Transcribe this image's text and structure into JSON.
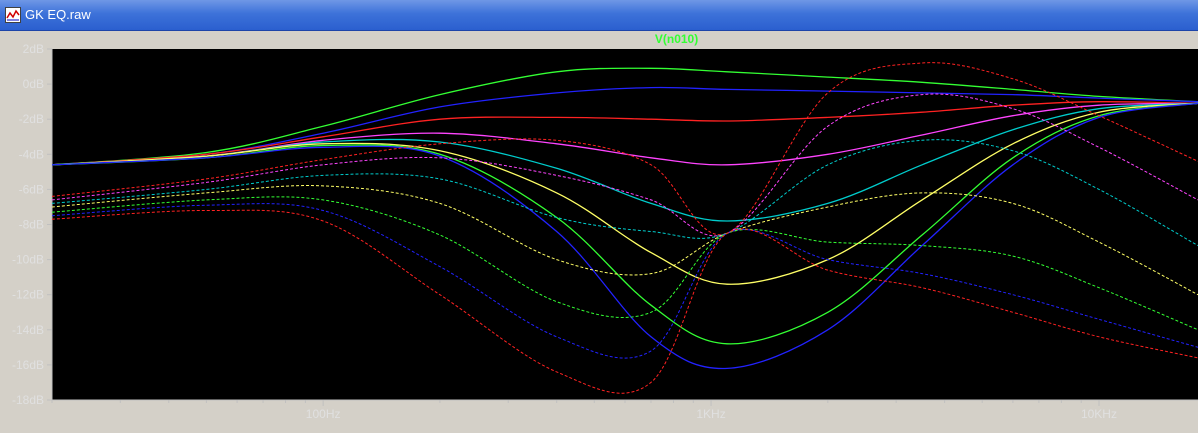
{
  "window": {
    "title": "GK EQ.raw",
    "icon": "waveform-icon"
  },
  "colors": {
    "background": "#000000",
    "axis": "#c0c0c0",
    "trace_title": "#33ff33",
    "palette": [
      "#33ff33",
      "#2222ff",
      "#ff2222",
      "#ff44ff",
      "#00cccc",
      "#ffff66"
    ]
  },
  "chart_data": {
    "type": "line",
    "title": "V(n010)",
    "xlabel": "",
    "ylabel": "",
    "x_scale": "log",
    "xlim": [
      20,
      18000
    ],
    "ylim": [
      -18,
      2
    ],
    "x_ticks": [
      {
        "value": 100,
        "label": "100Hz"
      },
      {
        "value": 1000,
        "label": "1KHz"
      },
      {
        "value": 10000,
        "label": "10KHz"
      }
    ],
    "y_ticks": [
      {
        "value": 2,
        "label": "2dB"
      },
      {
        "value": 0,
        "label": "0dB"
      },
      {
        "value": -2,
        "label": "-2dB"
      },
      {
        "value": -4,
        "label": "-4dB"
      },
      {
        "value": -6,
        "label": "-6dB"
      },
      {
        "value": -8,
        "label": "-8dB"
      },
      {
        "value": -10,
        "label": "-10dB"
      },
      {
        "value": -12,
        "label": "-12dB"
      },
      {
        "value": -14,
        "label": "-14dB"
      },
      {
        "value": -16,
        "label": "-16dB"
      },
      {
        "value": -18,
        "label": "-18dB"
      }
    ],
    "grid": false,
    "legend": "none",
    "x": [
      20,
      50,
      100,
      200,
      400,
      700,
      1100,
      2000,
      3500,
      6000,
      10000,
      18000
    ],
    "series": [
      {
        "style": "solid",
        "values": [
          -4.6,
          -3.9,
          -2.4,
          -0.6,
          0.7,
          0.9,
          0.7,
          0.4,
          0.1,
          -0.3,
          -0.7,
          -1.0
        ]
      },
      {
        "style": "solid",
        "values": [
          -4.6,
          -4.0,
          -2.8,
          -1.3,
          -0.5,
          -0.2,
          -0.3,
          -0.4,
          -0.5,
          -0.6,
          -0.8,
          -1.0
        ]
      },
      {
        "style": "solid",
        "values": [
          -4.6,
          -4.0,
          -3.0,
          -2.0,
          -1.9,
          -2.0,
          -2.1,
          -1.9,
          -1.6,
          -1.2,
          -1.0,
          -1.1
        ]
      },
      {
        "style": "solid",
        "values": [
          -4.6,
          -4.1,
          -3.2,
          -2.8,
          -3.4,
          -4.2,
          -4.6,
          -4.0,
          -2.9,
          -1.8,
          -1.2,
          -1.1
        ]
      },
      {
        "style": "solid",
        "values": [
          -4.6,
          -4.1,
          -3.3,
          -3.3,
          -4.8,
          -6.8,
          -7.8,
          -6.8,
          -4.6,
          -2.6,
          -1.4,
          -1.1
        ]
      },
      {
        "style": "solid",
        "values": [
          -4.6,
          -4.1,
          -3.4,
          -3.8,
          -6.2,
          -9.6,
          -11.4,
          -10.0,
          -6.6,
          -3.4,
          -1.6,
          -1.1
        ]
      },
      {
        "style": "solid",
        "values": [
          -4.6,
          -4.2,
          -3.5,
          -4.0,
          -7.6,
          -12.6,
          -14.8,
          -13.0,
          -8.6,
          -4.2,
          -1.8,
          -1.1
        ]
      },
      {
        "style": "solid",
        "values": [
          -4.6,
          -4.2,
          -3.6,
          -4.1,
          -8.4,
          -14.4,
          -16.2,
          -14.0,
          -9.2,
          -4.6,
          -1.9,
          -1.1
        ]
      },
      {
        "style": "dashed",
        "values": [
          -6.4,
          -5.4,
          -4.3,
          -3.4,
          -3.2,
          -4.6,
          -8.5,
          -0.5,
          1.2,
          0.3,
          -1.8,
          -4.4
        ]
      },
      {
        "style": "dashed",
        "values": [
          -6.6,
          -5.6,
          -4.6,
          -4.2,
          -5.2,
          -6.6,
          -8.5,
          -2.4,
          -0.6,
          -1.4,
          -3.6,
          -6.6
        ]
      },
      {
        "style": "dashed",
        "values": [
          -6.8,
          -6.0,
          -5.2,
          -5.4,
          -7.6,
          -8.4,
          -8.5,
          -4.6,
          -3.2,
          -3.8,
          -6.0,
          -9.2
        ]
      },
      {
        "style": "dashed",
        "values": [
          -7.0,
          -6.2,
          -5.8,
          -6.8,
          -10.0,
          -10.8,
          -8.5,
          -7.0,
          -6.2,
          -6.8,
          -9.0,
          -12.0
        ]
      },
      {
        "style": "dashed",
        "values": [
          -7.3,
          -6.6,
          -6.6,
          -8.6,
          -12.4,
          -13.0,
          -8.5,
          -9.0,
          -9.2,
          -9.8,
          -11.6,
          -14.0
        ]
      },
      {
        "style": "dashed",
        "values": [
          -7.5,
          -6.9,
          -7.2,
          -10.4,
          -14.4,
          -15.2,
          -8.5,
          -10.0,
          -10.8,
          -12.0,
          -13.4,
          -15.0
        ]
      },
      {
        "style": "dashed",
        "values": [
          -7.7,
          -7.2,
          -7.8,
          -12.0,
          -16.4,
          -17.0,
          -8.5,
          -10.6,
          -11.6,
          -13.0,
          -14.4,
          -15.6
        ]
      }
    ]
  }
}
